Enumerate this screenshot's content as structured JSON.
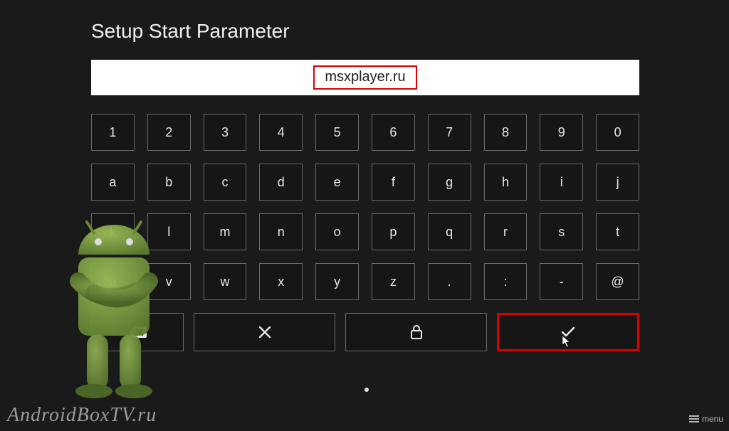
{
  "title": "Setup Start Parameter",
  "input_value": "msxplayer.ru",
  "keyboard": {
    "row1": [
      "1",
      "2",
      "3",
      "4",
      "5",
      "6",
      "7",
      "8",
      "9",
      "0"
    ],
    "row2": [
      "a",
      "b",
      "c",
      "d",
      "e",
      "f",
      "g",
      "h",
      "i",
      "j"
    ],
    "row3": [
      "k",
      "l",
      "m",
      "n",
      "o",
      "p",
      "q",
      "r",
      "s",
      "t"
    ],
    "row4": [
      "u",
      "v",
      "w",
      "x",
      "y",
      "z",
      ".",
      ":",
      "-",
      "@"
    ]
  },
  "function_keys": {
    "backspace_icon": "backspace-icon",
    "clear_icon": "close-x-icon",
    "lock_icon": "lock-icon",
    "confirm_icon": "check-icon"
  },
  "watermark": "AndroidBoxTV.ru",
  "menu_label": "menu",
  "colors": {
    "highlight_red": "#d80000",
    "bg": "#1a1a1a",
    "key_border": "#6a6a6a",
    "android_green": "#88b04b"
  }
}
